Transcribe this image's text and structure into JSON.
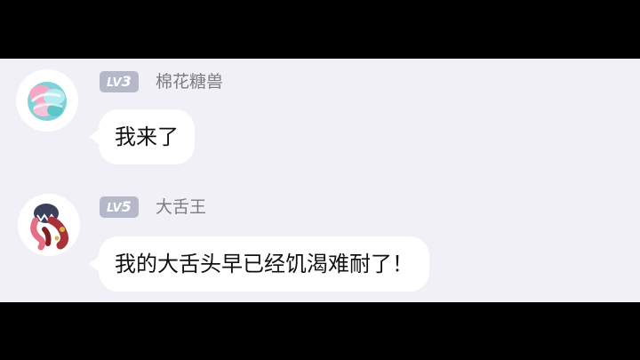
{
  "messages": [
    {
      "level_prefix": "LV",
      "level_number": "3",
      "username": "棉花糖兽",
      "text": "我来了",
      "avatar_icon": "cotton-candy-monster-icon"
    },
    {
      "level_prefix": "LV",
      "level_number": "5",
      "username": "大舌王",
      "text": "我的大舌头早已经饥渴难耐了！",
      "avatar_icon": "big-tongue-monster-icon"
    }
  ],
  "colors": {
    "background": "#f0f0f6",
    "bubble": "#ffffff",
    "level_badge": "#b4b8c8",
    "username": "#7b7b83",
    "letterbox": "#000000"
  }
}
